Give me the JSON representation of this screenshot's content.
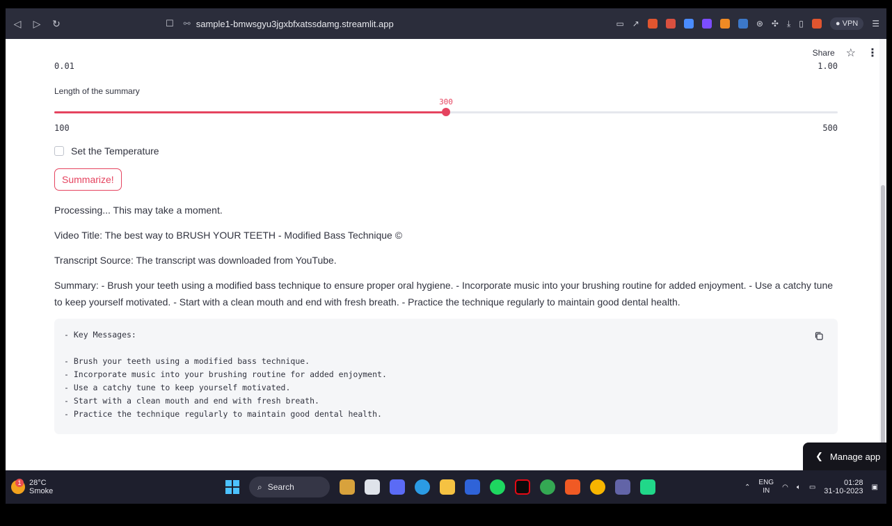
{
  "browser": {
    "url": "sample1-bmwsgyu3jgxbfxatssdamg.streamlit.app",
    "vpn_label": "VPN"
  },
  "header": {
    "share_label": "Share"
  },
  "top_range": {
    "min_label": "0.01",
    "max_label": "1.00"
  },
  "slider": {
    "label": "Length of the summary",
    "value": 300,
    "value_label": "300",
    "min": 100,
    "max": 500,
    "min_label": "100",
    "max_label": "500",
    "accent": "#e5435f"
  },
  "checkbox": {
    "label": "Set the Temperature",
    "checked": false
  },
  "button": {
    "label": "Summarize!"
  },
  "output": {
    "processing": "Processing... This may take a moment.",
    "video_title": "Video Title: The best way to BRUSH YOUR TEETH - Modified Bass Technique ©",
    "transcript_source": "Transcript Source: The transcript was downloaded from YouTube.",
    "summary": "Summary: - Brush your teeth using a modified bass technique to ensure proper oral hygiene. - Incorporate music into your brushing routine for added enjoyment. - Use a catchy tune to keep yourself motivated. - Start with a clean mouth and end with fresh breath. - Practice the technique regularly to maintain good dental health."
  },
  "code_block": {
    "lines": [
      "- Key Messages:",
      "",
      "- Brush your teeth using a modified bass technique.",
      "- Incorporate music into your brushing routine for added enjoyment.",
      "- Use a catchy tune to keep yourself motivated.",
      "- Start with a clean mouth and end with fresh breath.",
      "- Practice the technique regularly to maintain good dental health."
    ]
  },
  "manage_app": {
    "label": "Manage app"
  },
  "taskbar": {
    "weather_temp": "28°C",
    "weather_desc": "Smoke",
    "weather_badge": "1",
    "search_label": "Search",
    "lang_top": "ENG",
    "lang_bottom": "IN",
    "time": "01:28",
    "date": "31-10-2023"
  }
}
